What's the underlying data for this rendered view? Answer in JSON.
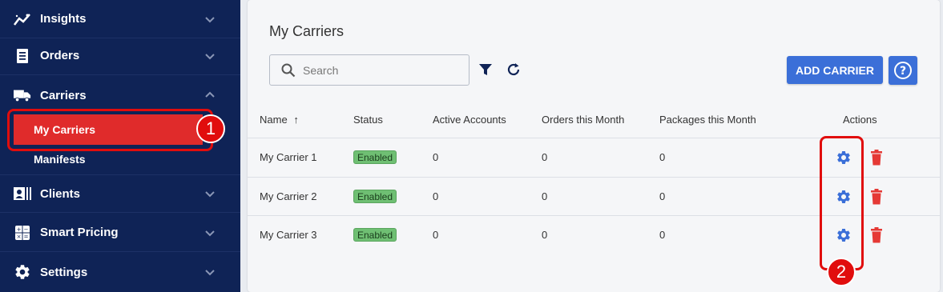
{
  "sidebar": {
    "items": [
      {
        "label": "Insights",
        "icon": "chart-line-icon"
      },
      {
        "label": "Orders",
        "icon": "document-icon"
      },
      {
        "label": "Carriers",
        "icon": "truck-icon"
      },
      {
        "label": "Clients",
        "icon": "contacts-icon"
      },
      {
        "label": "Smart Pricing",
        "icon": "calculator-icon"
      },
      {
        "label": "Settings",
        "icon": "gear-icon"
      }
    ],
    "sub_items": [
      {
        "label": "My Carriers",
        "active": true
      },
      {
        "label": "Manifests",
        "active": false
      }
    ]
  },
  "callouts": [
    "1",
    "2"
  ],
  "main": {
    "title": "My Carriers",
    "search_placeholder": "Search",
    "add_button": "ADD CARRIER",
    "table": {
      "headers": [
        "Name",
        "Status",
        "Active Accounts",
        "Orders this Month",
        "Packages this Month",
        "Actions"
      ],
      "sort_indicator": "↑",
      "rows": [
        {
          "name": "My Carrier 1",
          "status": "Enabled",
          "active_accounts": "0",
          "orders": "0",
          "packages": "0"
        },
        {
          "name": "My Carrier 2",
          "status": "Enabled",
          "active_accounts": "0",
          "orders": "0",
          "packages": "0"
        },
        {
          "name": "My Carrier 3",
          "status": "Enabled",
          "active_accounts": "0",
          "orders": "0",
          "packages": "0"
        }
      ]
    }
  },
  "colors": {
    "sidebar_bg": "#0f2356",
    "accent_blue": "#3b6fd8",
    "active_red": "#e02b2b",
    "callout_red": "#e10d0d",
    "badge_green": "#6fbf73",
    "trash_red": "#e53935"
  }
}
